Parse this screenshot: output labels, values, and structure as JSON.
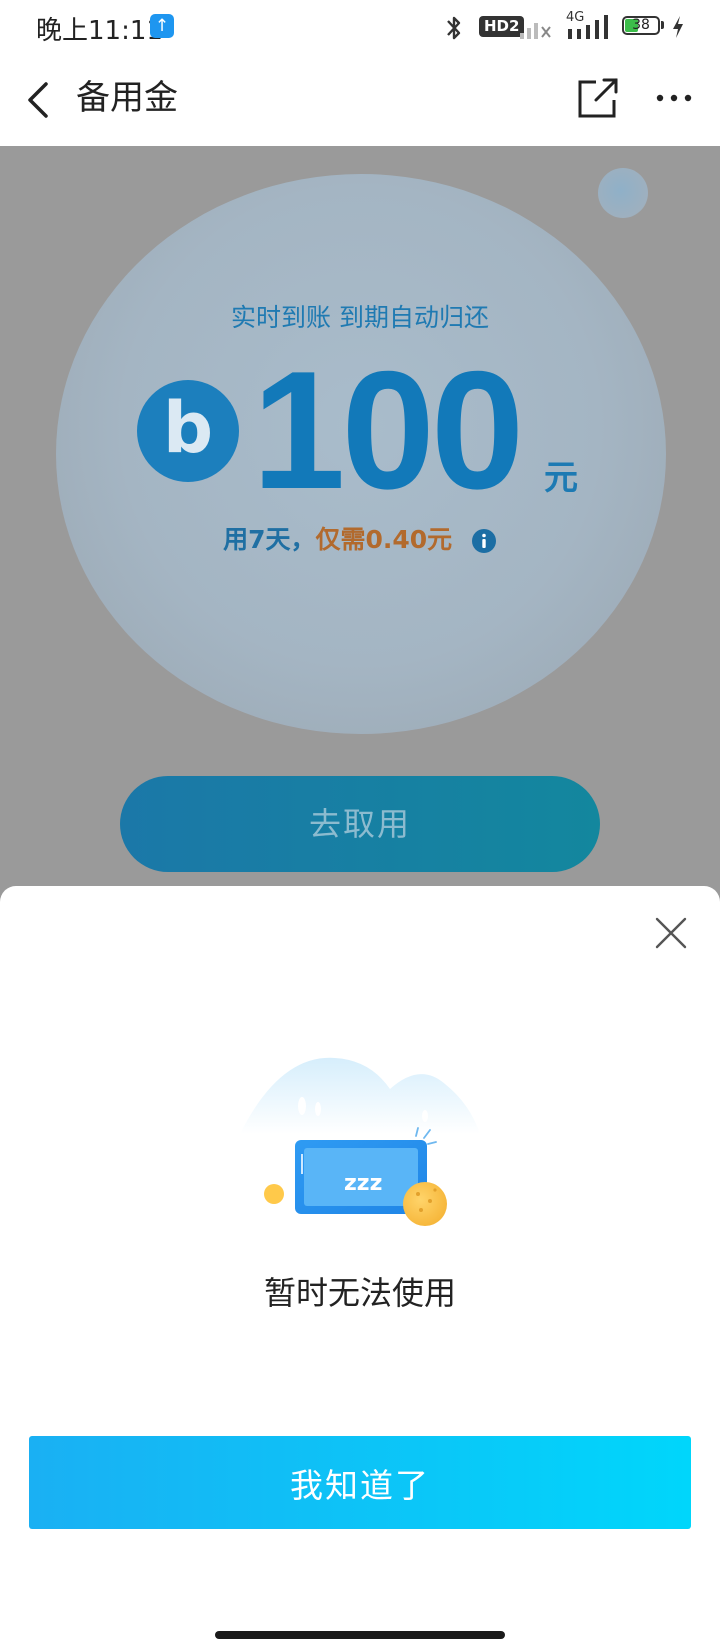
{
  "status_bar": {
    "time": "晚上11:11",
    "upload_icon": "upload-arrow-icon",
    "bluetooth_icon": "bluetooth-icon",
    "hd_badge": "HD2",
    "network_label": "4G",
    "battery_level": "38",
    "charging_icon": "lightning-icon"
  },
  "nav": {
    "title": "备用金",
    "back_icon": "chevron-left-icon",
    "share_icon": "share-icon",
    "more_icon": "more-dots-icon"
  },
  "hero": {
    "subtitle": "实时到账 到期自动归还",
    "logo_letter": "b",
    "amount": "100",
    "unit": "元",
    "fee_prefix": "用7天，",
    "fee_cost": "仅需0.40元",
    "cta_label": "去取用"
  },
  "sheet": {
    "close_icon": "close-icon",
    "illustration_text": "zzz",
    "message": "暂时无法使用",
    "confirm_label": "我知道了"
  },
  "colors": {
    "overlay": "#9a9a9a",
    "brand_blue": "#1279b9",
    "accent_orange": "#b26a2d",
    "button_start": "#1ab0f3",
    "button_end": "#00d6fb"
  }
}
